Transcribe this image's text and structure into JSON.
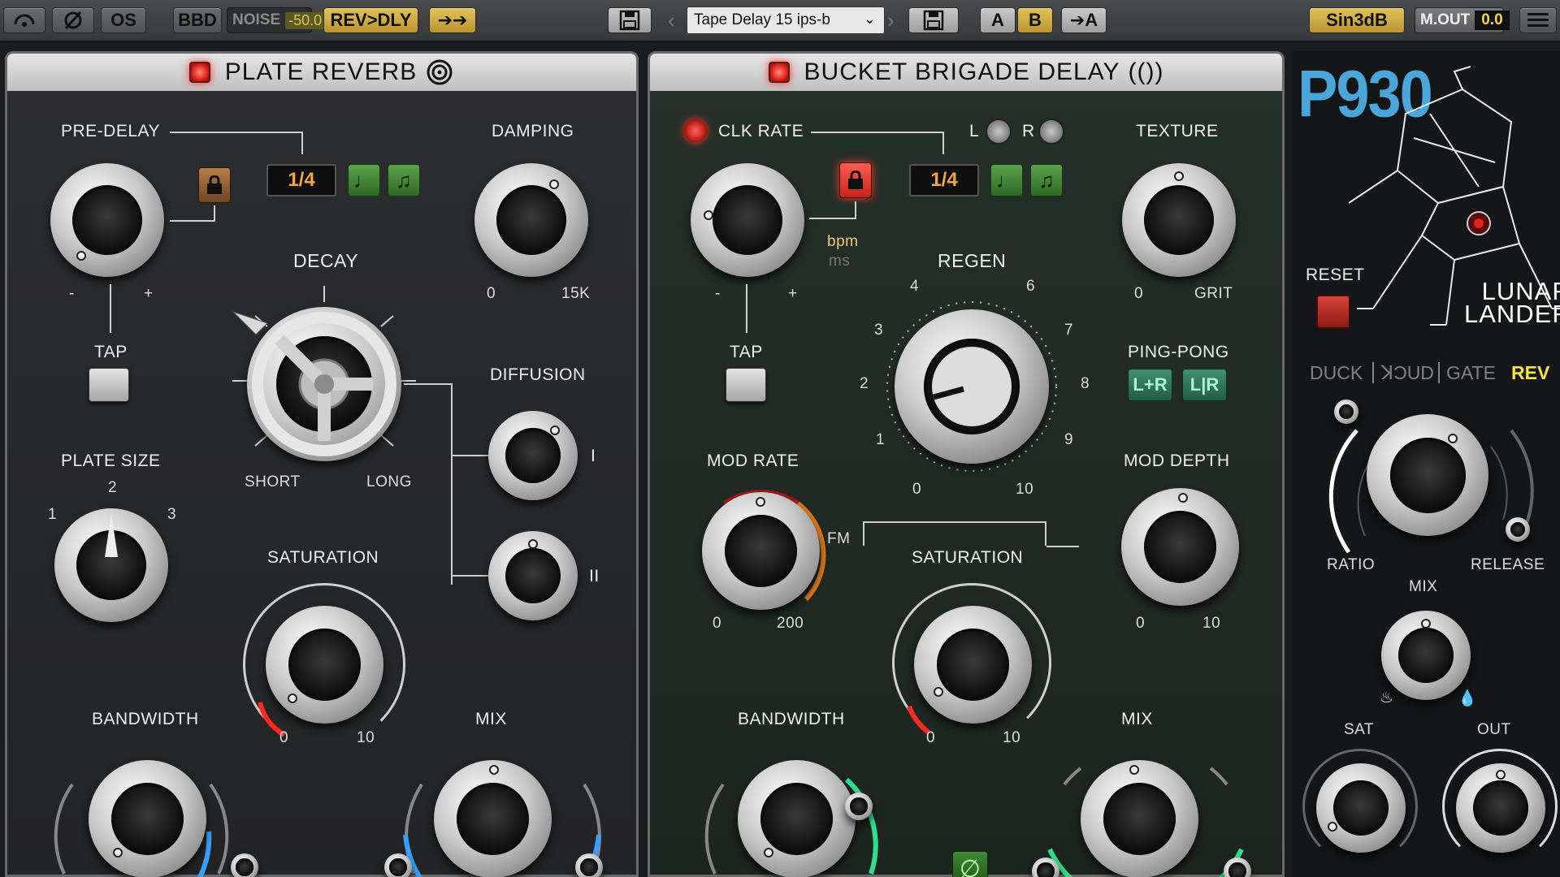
{
  "toolbar": {
    "os_label": "OS",
    "bbd_label": "BBD",
    "noise_label": "NOISE",
    "noise_value": "-50.0",
    "routing_label": "REV>DLY",
    "forward_label": "➔➔",
    "preset_name": "Tape Delay 15 ips-b",
    "a_label": "A",
    "b_label": "B",
    "copy_a_label": "➔A",
    "sin_label": "Sin3dB",
    "mout_label": "M.OUT",
    "mout_value": "0.0"
  },
  "reverb": {
    "title": "PLATE REVERB",
    "predelay_label": "PRE-DELAY",
    "minus": "-",
    "plus": "+",
    "division": "1/4",
    "tap_label": "TAP",
    "damping_label": "DAMPING",
    "damping_min": "0",
    "damping_max": "15K",
    "decay_label": "DECAY",
    "decay_short": "SHORT",
    "decay_long": "LONG",
    "diffusion_label": "DIFFUSION",
    "diffusion_1": "I",
    "diffusion_2": "II",
    "plate_size_label": "PLATE SIZE",
    "plate_1": "1",
    "plate_2": "2",
    "plate_3": "3",
    "saturation_label": "SATURATION",
    "sat_min": "0",
    "sat_max": "10",
    "bandwidth_label": "BANDWIDTH",
    "mix_label": "MIX"
  },
  "delay": {
    "title": "BUCKET BRIGADE DELAY",
    "clk_rate_label": "CLK RATE",
    "l_label": "L",
    "r_label": "R",
    "texture_label": "TEXTURE",
    "texture_min": "0",
    "texture_max": "GRIT",
    "division": "1/4",
    "bpm_label": "bpm",
    "ms_label": "ms",
    "minus": "-",
    "plus": "+",
    "tap_label": "TAP",
    "regen_label": "REGEN",
    "regen_scale": [
      "0",
      "1",
      "2",
      "3",
      "4",
      "6",
      "7",
      "8",
      "9",
      "10"
    ],
    "ping_pong_label": "PING-PONG",
    "pp_lr": "L+R",
    "pp_split": "L|R",
    "mod_rate_label": "MOD RATE",
    "mod_rate_min": "0",
    "mod_rate_max": "200",
    "fm_label": "FM",
    "mod_depth_label": "MOD DEPTH",
    "mod_depth_min": "0",
    "mod_depth_max": "10",
    "saturation_label": "SATURATION",
    "sat_min": "0",
    "sat_max": "10",
    "bandwidth_label": "BANDWIDTH",
    "mix_label": "MIX"
  },
  "lunar": {
    "logo": "P930",
    "brand_line1": "LUNAR",
    "brand_line2": "LANDER",
    "reset_label": "RESET",
    "tabs": [
      "DUCK",
      "ꓘƆUD",
      "GATE",
      "REV"
    ],
    "active_tab": "REV",
    "ratio_label": "RATIO",
    "release_label": "RELEASE",
    "mix_label": "MIX",
    "sat_label": "SAT",
    "out_label": "OUT"
  },
  "colors": {
    "accent_gold": "#e2c25a",
    "led_red": "#e0221b",
    "blue_arc": "#3aa0ff",
    "green_arc": "#2fe08a",
    "orange_arc": "#e07a1a"
  }
}
